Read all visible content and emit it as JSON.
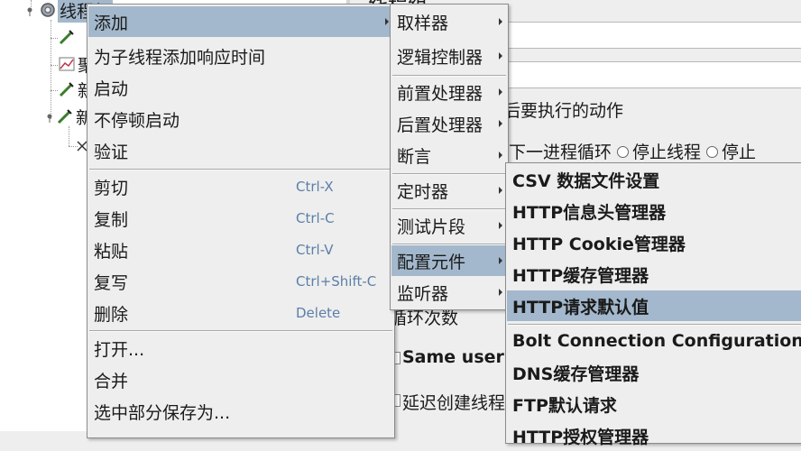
{
  "tree": {
    "root_label": "线程组",
    "child_labels": [
      "",
      "聚",
      "新",
      "新"
    ]
  },
  "editor": {
    "section_title": "线程组",
    "action_title": "后要执行的动作",
    "radio_next_loop": "下一进程循环",
    "radio_stop_thread": "停止线程",
    "radio_stop_test": "停止",
    "loop_count": "循环次数",
    "same_user": "Same user",
    "delay_create": "延迟创建线程"
  },
  "context_menu": {
    "items": [
      {
        "label": "添加",
        "shortcut": ""
      },
      {
        "label": "为子线程添加响应时间",
        "shortcut": ""
      },
      {
        "label": "启动",
        "shortcut": ""
      },
      {
        "label": "不停顿启动",
        "shortcut": ""
      },
      {
        "label": "验证",
        "shortcut": ""
      },
      {
        "label": "剪切",
        "shortcut": "Ctrl-X"
      },
      {
        "label": "复制",
        "shortcut": "Ctrl-C"
      },
      {
        "label": "粘贴",
        "shortcut": "Ctrl-V"
      },
      {
        "label": "复写",
        "shortcut": "Ctrl+Shift-C"
      },
      {
        "label": "删除",
        "shortcut": "Delete"
      },
      {
        "label": "打开...",
        "shortcut": ""
      },
      {
        "label": "合并",
        "shortcut": ""
      },
      {
        "label": "选中部分保存为...",
        "shortcut": ""
      }
    ]
  },
  "add_menu": {
    "items": [
      "取样器",
      "逻辑控制器",
      "前置处理器",
      "后置处理器",
      "断言",
      "定时器",
      "测试片段",
      "配置元件",
      "监听器"
    ]
  },
  "config_menu": {
    "items": [
      "CSV 数据文件设置",
      "HTTP信息头管理器",
      "HTTP Cookie管理器",
      "HTTP缓存管理器",
      "HTTP请求默认值",
      "Bolt Connection Configuration",
      "DNS缓存管理器",
      "FTP默认请求",
      "HTTP授权管理器"
    ]
  },
  "colors": {
    "selection": "#a3b8cc",
    "menu_bg": "#eeeeee",
    "shortcut": "#5b7fa8"
  }
}
